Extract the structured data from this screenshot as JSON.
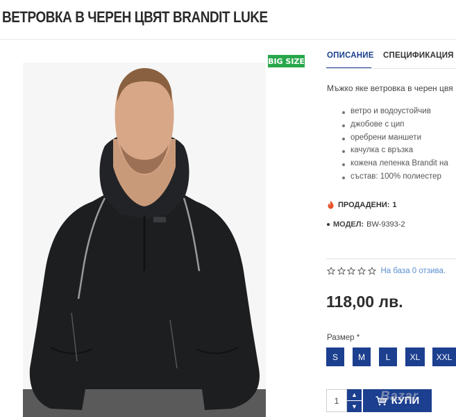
{
  "product": {
    "title": "ВЕТРОВКА В ЧЕРЕН ЦВЯТ BRANDIT LUKE",
    "badge": "BIG SIZE"
  },
  "tabs": [
    {
      "label": "ОПИСАНИЕ",
      "active": true
    },
    {
      "label": "СПЕЦИФИКАЦИЯ",
      "active": false
    }
  ],
  "description": {
    "intro": "Мъжко яке ветровка в черен цвя",
    "features": [
      "ветро и водоустойчив",
      "джобове с цип",
      "оребрени маншети",
      "качулка с връзка",
      "кожена лепенка Brandit на",
      "състав: 100% полиестер"
    ]
  },
  "sold": {
    "label": "ПРОДАДЕНИ:",
    "value": "1"
  },
  "model": {
    "label": "МОДЕЛ:",
    "value": "BW-9393-2"
  },
  "rating": {
    "stars": 0,
    "max": 5,
    "text": "На база 0 отзива."
  },
  "price": "118,00 лв.",
  "size": {
    "label": "Размер",
    "required": "*",
    "options": [
      "S",
      "M",
      "L",
      "XL",
      "XXL"
    ]
  },
  "cart": {
    "quantity": "1",
    "button_label": "КУПИ"
  },
  "watermark": "Bazar",
  "colors": {
    "brand": "#1c3f8f",
    "badge": "#27a74a",
    "link": "#5b8fd0"
  }
}
